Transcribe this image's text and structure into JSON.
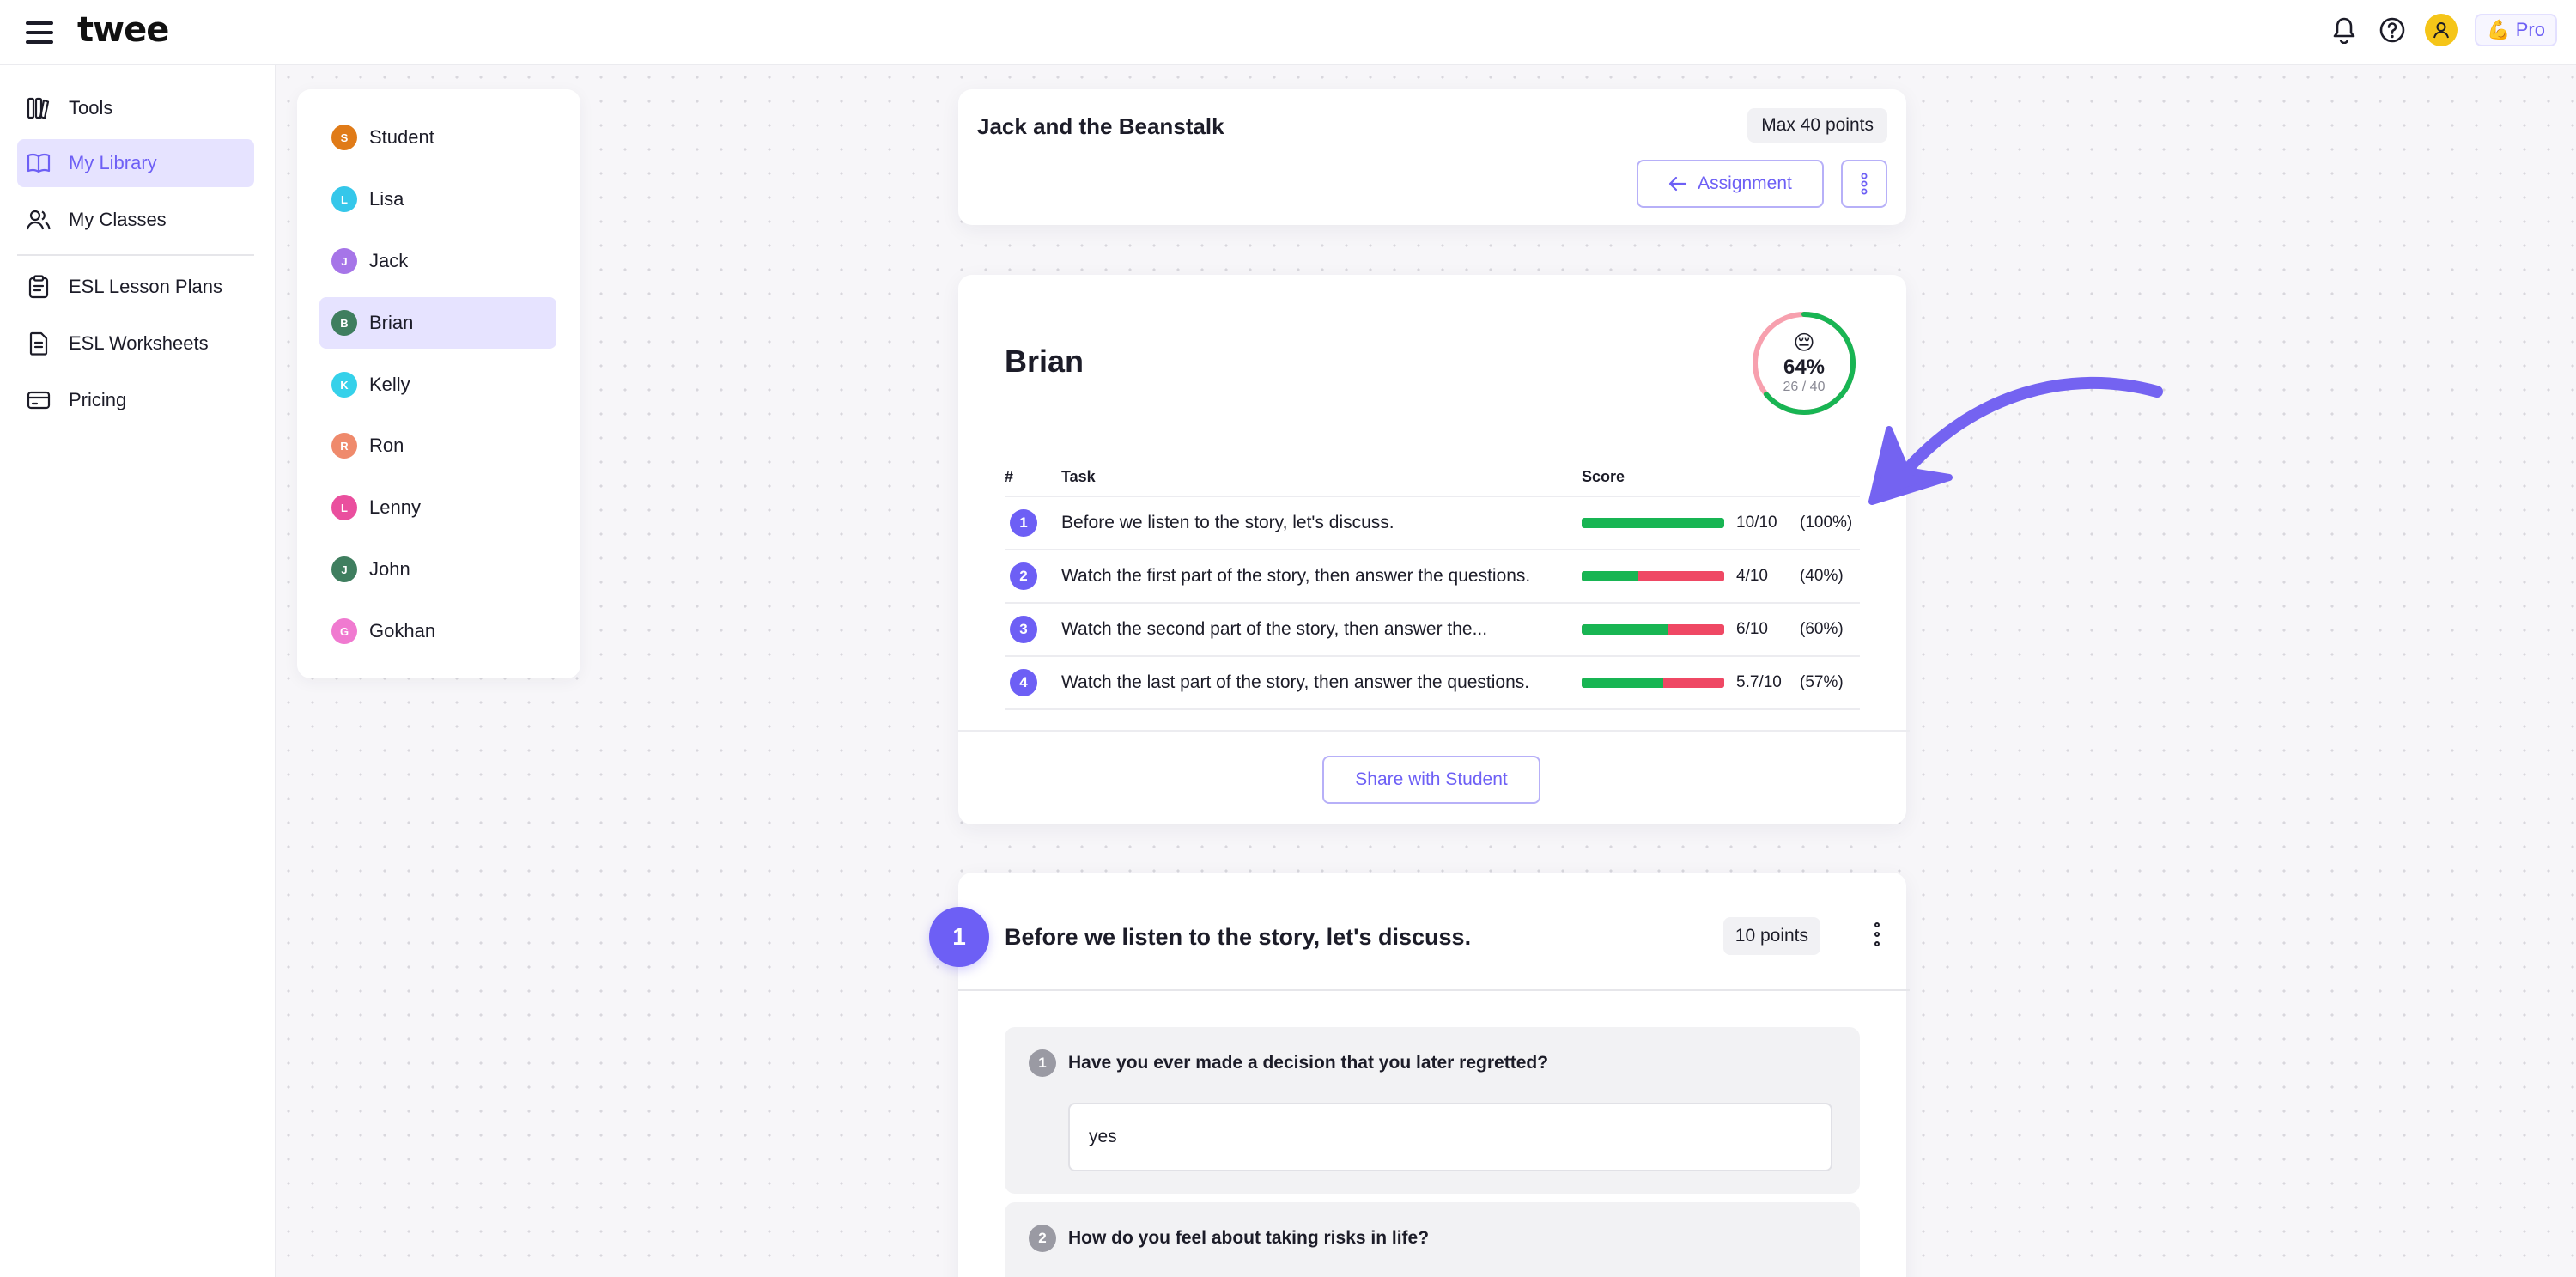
{
  "app": {
    "logo": "twee",
    "pro_label": "Pro",
    "pro_icon": "💪"
  },
  "sidebar": {
    "items": [
      {
        "label": "Tools",
        "icon": "tools-icon"
      },
      {
        "label": "My Library",
        "icon": "library-icon",
        "active": true
      },
      {
        "label": "My Classes",
        "icon": "classes-icon"
      },
      {
        "label": "ESL Lesson Plans",
        "icon": "lesson-plans-icon"
      },
      {
        "label": "ESL Worksheets",
        "icon": "worksheets-icon"
      },
      {
        "label": "Pricing",
        "icon": "pricing-icon"
      }
    ]
  },
  "students": {
    "items": [
      {
        "name": "Student",
        "initial": "S",
        "color": "#e07b18"
      },
      {
        "name": "Lisa",
        "initial": "L",
        "color": "#35c7ea"
      },
      {
        "name": "Jack",
        "initial": "J",
        "color": "#a675e8"
      },
      {
        "name": "Brian",
        "initial": "B",
        "color": "#3f7e5f",
        "active": true
      },
      {
        "name": "Kelly",
        "initial": "K",
        "color": "#35d1ea"
      },
      {
        "name": "Ron",
        "initial": "R",
        "color": "#ef8a6c"
      },
      {
        "name": "Lenny",
        "initial": "L",
        "color": "#ea4f9e"
      },
      {
        "name": "John",
        "initial": "J",
        "color": "#3f7e5f"
      },
      {
        "name": "Gokhan",
        "initial": "G",
        "color": "#f07ad0"
      }
    ]
  },
  "assignment": {
    "title": "Jack and the Beanstalk",
    "max_points": "Max 40 points",
    "assignment_button": "Assignment"
  },
  "result": {
    "student_name": "Brian",
    "emoji": "😔",
    "percent": "64%",
    "points": "26 / 40",
    "percent_value": 64,
    "columns": {
      "num": "#",
      "task": "Task",
      "score": "Score"
    },
    "rows": [
      {
        "num": "1",
        "task": "Before we listen to the story, let's discuss.",
        "score": "10/10",
        "pct": "(100%)",
        "fill": 100
      },
      {
        "num": "2",
        "task": "Watch the first part of the story, then answer the questions.",
        "score": "4/10",
        "pct": "(40%)",
        "fill": 40
      },
      {
        "num": "3",
        "task": "Watch the second part of the story, then answer the...",
        "score": "6/10",
        "pct": "(60%)",
        "fill": 60
      },
      {
        "num": "4",
        "task": "Watch the last part of the story, then answer the questions.",
        "score": "5.7/10",
        "pct": "(57%)",
        "fill": 57
      }
    ],
    "share_button": "Share with Student"
  },
  "task_section": {
    "number": "1",
    "title": "Before we listen to the story, let's discuss.",
    "points": "10 points",
    "questions": [
      {
        "num": "1",
        "text": "Have you ever made a decision that you later regretted?",
        "answer": "yes"
      },
      {
        "num": "2",
        "text": "How do you feel about taking risks in life?"
      }
    ]
  },
  "colors": {
    "accent": "#6d5ff5",
    "good": "#18b553",
    "bad": "#ef4864"
  }
}
